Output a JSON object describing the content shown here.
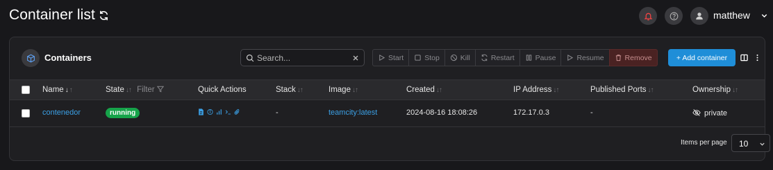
{
  "header": {
    "title": "Container list",
    "username": "matthew",
    "icons": [
      "refresh-icon",
      "bell-icon",
      "help-icon",
      "user-avatar-icon",
      "chevron-down-icon"
    ]
  },
  "panel": {
    "title": "Containers",
    "search": {
      "placeholder": "Search...",
      "value": ""
    },
    "actions": {
      "start": "Start",
      "stop": "Stop",
      "kill": "Kill",
      "restart": "Restart",
      "pause": "Pause",
      "resume": "Resume",
      "remove": "Remove"
    },
    "add_button": "+ Add container"
  },
  "table": {
    "columns": {
      "name": "Name",
      "state": "State",
      "state_filter": "Filter",
      "quick_actions": "Quick Actions",
      "stack": "Stack",
      "image": "Image",
      "created": "Created",
      "ip": "IP Address",
      "ports": "Published Ports",
      "ownership": "Ownership"
    },
    "rows": [
      {
        "name": "contenedor",
        "state": "running",
        "stack": "-",
        "image": "teamcity:latest",
        "created": "2024-08-16 18:08:26",
        "ip": "172.17.0.3",
        "ports": "-",
        "ownership": "private"
      }
    ]
  },
  "footer": {
    "items_per_page_label": "Items per page",
    "items_per_page_value": "10"
  },
  "colors": {
    "background": "#18181b",
    "panel": "#1f1f22",
    "accent": "#1f8ed8",
    "running": "#16a34a",
    "link": "#3ba0e6",
    "remove": "#4a2222"
  }
}
